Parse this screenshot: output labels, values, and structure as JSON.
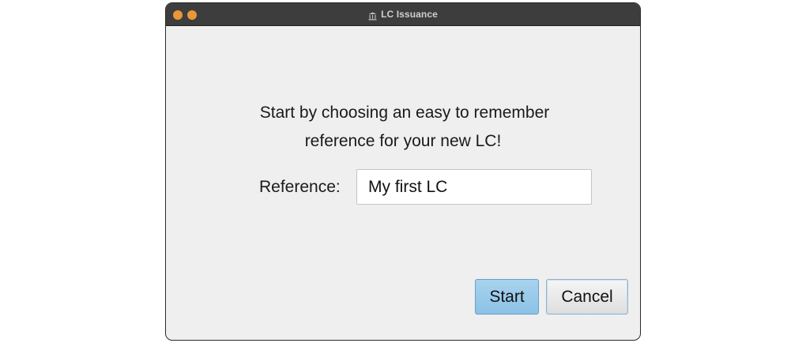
{
  "window": {
    "title": "LC Issuance",
    "title_icon": "bank-icon",
    "traffic_light_color": "#e9973a"
  },
  "intro": {
    "line1": "Start by choosing an easy to remember",
    "line2": "reference for your new LC!"
  },
  "reference": {
    "label": "Reference:",
    "value": "My first LC"
  },
  "buttons": {
    "start_label": "Start",
    "cancel_label": "Cancel",
    "start_color": "#8bc2e6"
  }
}
